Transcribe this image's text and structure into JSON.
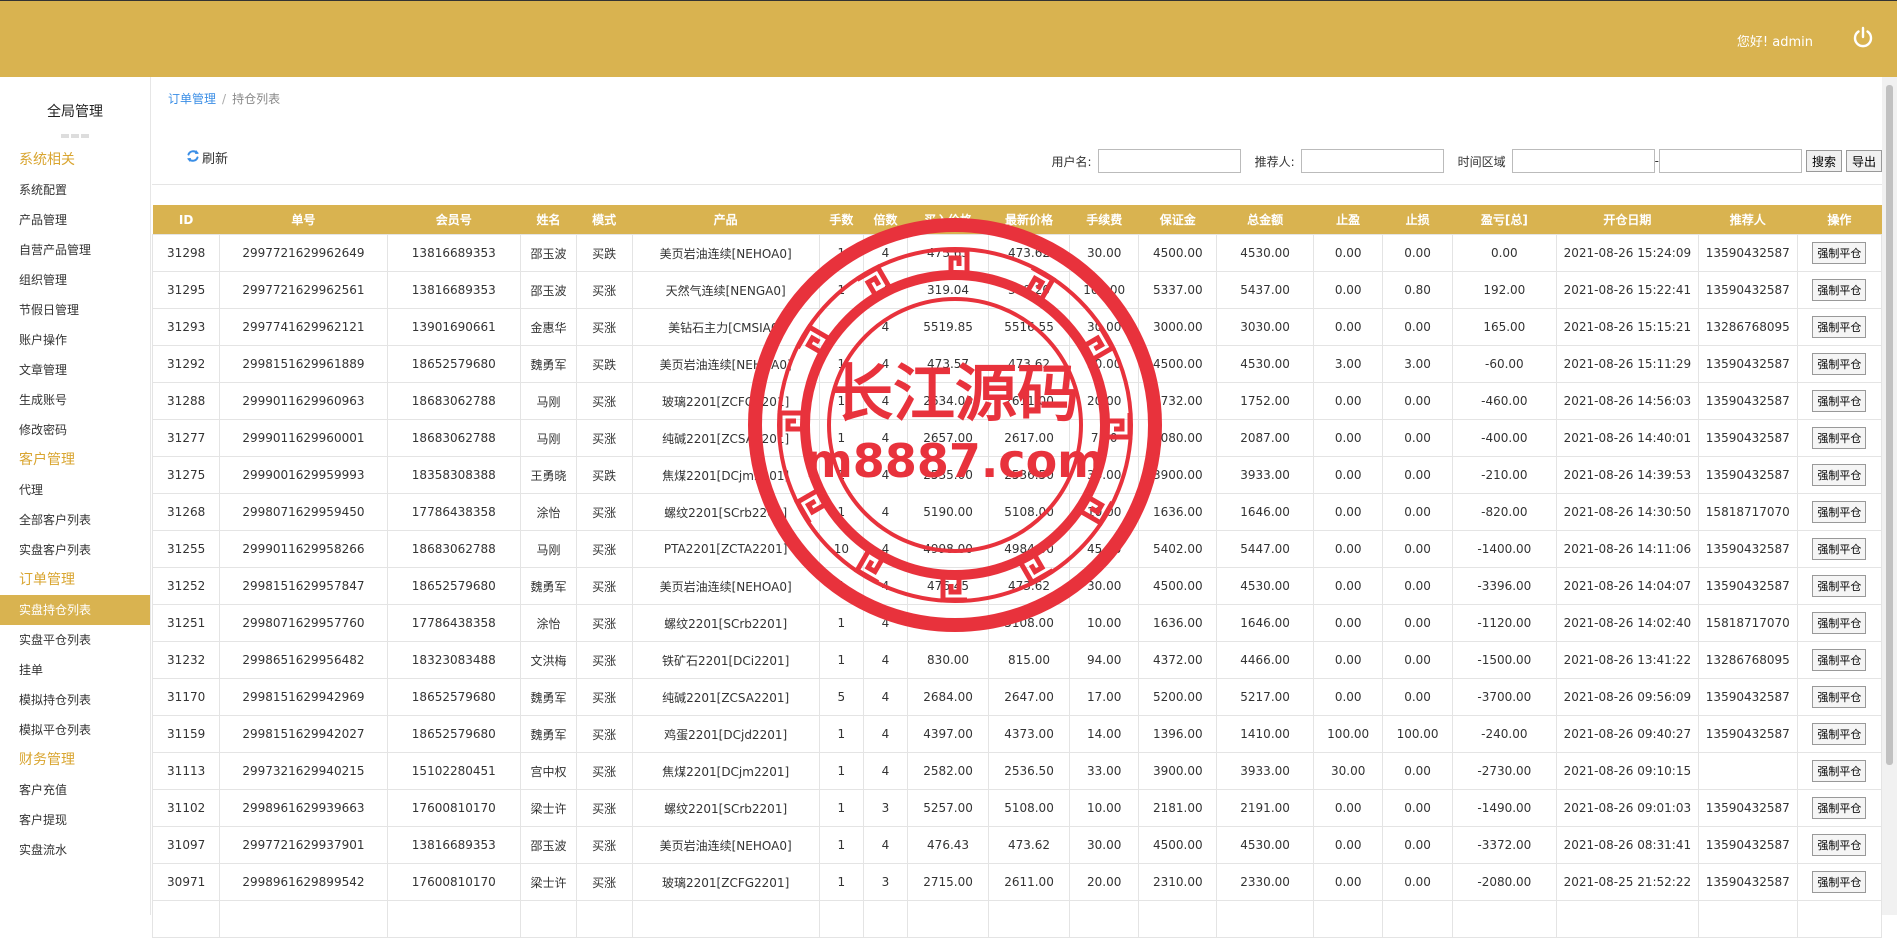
{
  "header": {
    "greeting": "您好! admin",
    "logout_icon": "power-icon"
  },
  "sidebar": {
    "title": "全局管理",
    "sections": [
      {
        "label": "系统相关",
        "items": [
          {
            "label": "系统配置"
          },
          {
            "label": "产品管理"
          },
          {
            "label": "自营产品管理"
          },
          {
            "label": "组织管理"
          },
          {
            "label": "节假日管理"
          },
          {
            "label": "账户操作"
          },
          {
            "label": "文章管理"
          },
          {
            "label": "生成账号"
          },
          {
            "label": "修改密码"
          }
        ]
      },
      {
        "label": "客户管理",
        "items": [
          {
            "label": "代理"
          },
          {
            "label": "全部客户列表"
          },
          {
            "label": "实盘客户列表"
          }
        ]
      },
      {
        "label": "订单管理",
        "items": [
          {
            "label": "实盘持仓列表",
            "active": true
          },
          {
            "label": "实盘平仓列表"
          },
          {
            "label": "挂单"
          },
          {
            "label": "模拟持仓列表"
          },
          {
            "label": "模拟平仓列表"
          }
        ]
      },
      {
        "label": "财务管理",
        "items": [
          {
            "label": "客户充值"
          },
          {
            "label": "客户提现"
          },
          {
            "label": "实盘流水"
          }
        ]
      }
    ]
  },
  "breadcrumb": {
    "parent": "订单管理",
    "separator": "/",
    "current": "持仓列表"
  },
  "toolbar": {
    "refresh_label": "刷新",
    "username_label": "用户名:",
    "username_value": "",
    "referrer_label": "推荐人:",
    "referrer_value": "",
    "time_label": "时间区域",
    "time_start": "",
    "time_sep": "-",
    "time_end": "",
    "search_label": "搜索",
    "export_label": "导出"
  },
  "table": {
    "columns": [
      "ID",
      "单号",
      "会员号",
      "姓名",
      "模式",
      "产品",
      "手数",
      "倍数",
      "买入价格",
      "最新价格",
      "手续费",
      "保证金",
      "总金额",
      "止盈",
      "止损",
      "盈亏[总]",
      "开仓日期",
      "推荐人",
      "操作"
    ],
    "action_label": "强制平仓",
    "rows": [
      [
        "31298",
        "2997721629962649",
        "13816689353",
        "邵玉波",
        "买跌",
        "美页岩油连续[NEHOA0]",
        "1",
        "4",
        "473.63",
        "473.62",
        "30.00",
        "4500.00",
        "4530.00",
        "0.00",
        "0.00",
        "0.00",
        "2021-08-26 15:24:09",
        "13590432587"
      ],
      [
        "31295",
        "2997721629962561",
        "13816689353",
        "邵玉波",
        "买涨",
        "天然气连续[NENGA0]",
        "1",
        "4",
        "319.04",
        "319.20",
        "100.00",
        "5337.00",
        "5437.00",
        "0.00",
        "0.80",
        "192.00",
        "2021-08-26 15:22:41",
        "13590432587"
      ],
      [
        "31293",
        "2997741629962121",
        "13901690661",
        "金惠华",
        "买涨",
        "美钻石主力[CMSIA0]",
        "1",
        "4",
        "5519.85",
        "5516.55",
        "30.00",
        "3000.00",
        "3030.00",
        "0.00",
        "0.00",
        "165.00",
        "2021-08-26 15:15:21",
        "13286768095"
      ],
      [
        "31292",
        "2998151629961889",
        "18652579680",
        "魏勇军",
        "买跌",
        "美页岩油连续[NEHOA0]",
        "1",
        "4",
        "473.57",
        "473.62",
        "30.00",
        "4500.00",
        "4530.00",
        "3.00",
        "3.00",
        "-60.00",
        "2021-08-26 15:11:29",
        "13590432587"
      ],
      [
        "31288",
        "2999011629960963",
        "18683062788",
        "马刚",
        "买涨",
        "玻璃2201[ZCFG2201]",
        "1",
        "4",
        "2634.00",
        "2611.00",
        "20.00",
        "1732.00",
        "1752.00",
        "0.00",
        "0.00",
        "-460.00",
        "2021-08-26 14:56:03",
        "13590432587"
      ],
      [
        "31277",
        "2999011629960001",
        "18683062788",
        "马刚",
        "买涨",
        "纯碱2201[ZCSA2201]",
        "1",
        "4",
        "2657.00",
        "2617.00",
        "7.00",
        "2080.00",
        "2087.00",
        "0.00",
        "0.00",
        "-400.00",
        "2021-08-26 14:40:01",
        "13590432587"
      ],
      [
        "31275",
        "2999001629959993",
        "18358308388",
        "王勇晓",
        "买跌",
        "焦煤2201[DCjm2201]",
        "1",
        "4",
        "2535.00",
        "2536.50",
        "33.00",
        "3900.00",
        "3933.00",
        "0.00",
        "0.00",
        "-210.00",
        "2021-08-26 14:39:53",
        "13590432587"
      ],
      [
        "31268",
        "2998071629959450",
        "17786438358",
        "涂怡",
        "买涨",
        "螺纹2201[SCrb2201]",
        "1",
        "4",
        "5190.00",
        "5108.00",
        "10.00",
        "1636.00",
        "1646.00",
        "0.00",
        "0.00",
        "-820.00",
        "2021-08-26 14:30:50",
        "15818717070"
      ],
      [
        "31255",
        "2999011629958266",
        "18683062788",
        "马刚",
        "买涨",
        "PTA2201[ZCTA2201]",
        "10",
        "4",
        "4998.00",
        "4984.00",
        "45.00",
        "5402.00",
        "5447.00",
        "0.00",
        "0.00",
        "-1400.00",
        "2021-08-26 14:11:06",
        "13590432587"
      ],
      [
        "31252",
        "2998151629957847",
        "18652579680",
        "魏勇军",
        "买涨",
        "美页岩油连续[NEHOA0]",
        "1",
        "4",
        "476.45",
        "473.62",
        "30.00",
        "4500.00",
        "4530.00",
        "0.00",
        "0.00",
        "-3396.00",
        "2021-08-26 14:04:07",
        "13590432587"
      ],
      [
        "31251",
        "2998071629957760",
        "17786438358",
        "涂怡",
        "买涨",
        "螺纹2201[SCrb2201]",
        "1",
        "4",
        "5220.00",
        "5108.00",
        "10.00",
        "1636.00",
        "1646.00",
        "0.00",
        "0.00",
        "-1120.00",
        "2021-08-26 14:02:40",
        "15818717070"
      ],
      [
        "31232",
        "2998651629956482",
        "18323083488",
        "文洪梅",
        "买涨",
        "铁矿石2201[DCi2201]",
        "1",
        "4",
        "830.00",
        "815.00",
        "94.00",
        "4372.00",
        "4466.00",
        "0.00",
        "0.00",
        "-1500.00",
        "2021-08-26 13:41:22",
        "13286768095"
      ],
      [
        "31170",
        "2998151629942969",
        "18652579680",
        "魏勇军",
        "买涨",
        "纯碱2201[ZCSA2201]",
        "5",
        "4",
        "2684.00",
        "2647.00",
        "17.00",
        "5200.00",
        "5217.00",
        "0.00",
        "0.00",
        "-3700.00",
        "2021-08-26 09:56:09",
        "13590432587"
      ],
      [
        "31159",
        "2998151629942027",
        "18652579680",
        "魏勇军",
        "买涨",
        "鸡蛋2201[DCjd2201]",
        "1",
        "4",
        "4397.00",
        "4373.00",
        "14.00",
        "1396.00",
        "1410.00",
        "100.00",
        "100.00",
        "-240.00",
        "2021-08-26 09:40:27",
        "13590432587"
      ],
      [
        "31113",
        "2997321629940215",
        "15102280451",
        "宫中权",
        "买涨",
        "焦煤2201[DCjm2201]",
        "1",
        "4",
        "2582.00",
        "2536.50",
        "33.00",
        "3900.00",
        "3933.00",
        "30.00",
        "0.00",
        "-2730.00",
        "2021-08-26 09:10:15",
        ""
      ],
      [
        "31102",
        "2998961629939663",
        "17600810170",
        "梁士许",
        "买涨",
        "螺纹2201[SCrb2201]",
        "1",
        "3",
        "5257.00",
        "5108.00",
        "10.00",
        "2181.00",
        "2191.00",
        "0.00",
        "0.00",
        "-1490.00",
        "2021-08-26 09:01:03",
        "13590432587"
      ],
      [
        "31097",
        "2997721629937901",
        "13816689353",
        "邵玉波",
        "买涨",
        "美页岩油连续[NEHOA0]",
        "1",
        "4",
        "476.43",
        "473.62",
        "30.00",
        "4500.00",
        "4530.00",
        "0.00",
        "0.00",
        "-3372.00",
        "2021-08-26 08:31:41",
        "13590432587"
      ],
      [
        "30971",
        "2998961629899542",
        "17600810170",
        "梁士许",
        "买涨",
        "玻璃2201[ZCFG2201]",
        "1",
        "3",
        "2715.00",
        "2611.00",
        "20.00",
        "2310.00",
        "2330.00",
        "0.00",
        "0.00",
        "-2080.00",
        "2021-08-25 21:52:22",
        "13590432587"
      ]
    ]
  },
  "watermark": {
    "title": "长江源码",
    "url": "m8887.com",
    "color": "#e8323c"
  }
}
